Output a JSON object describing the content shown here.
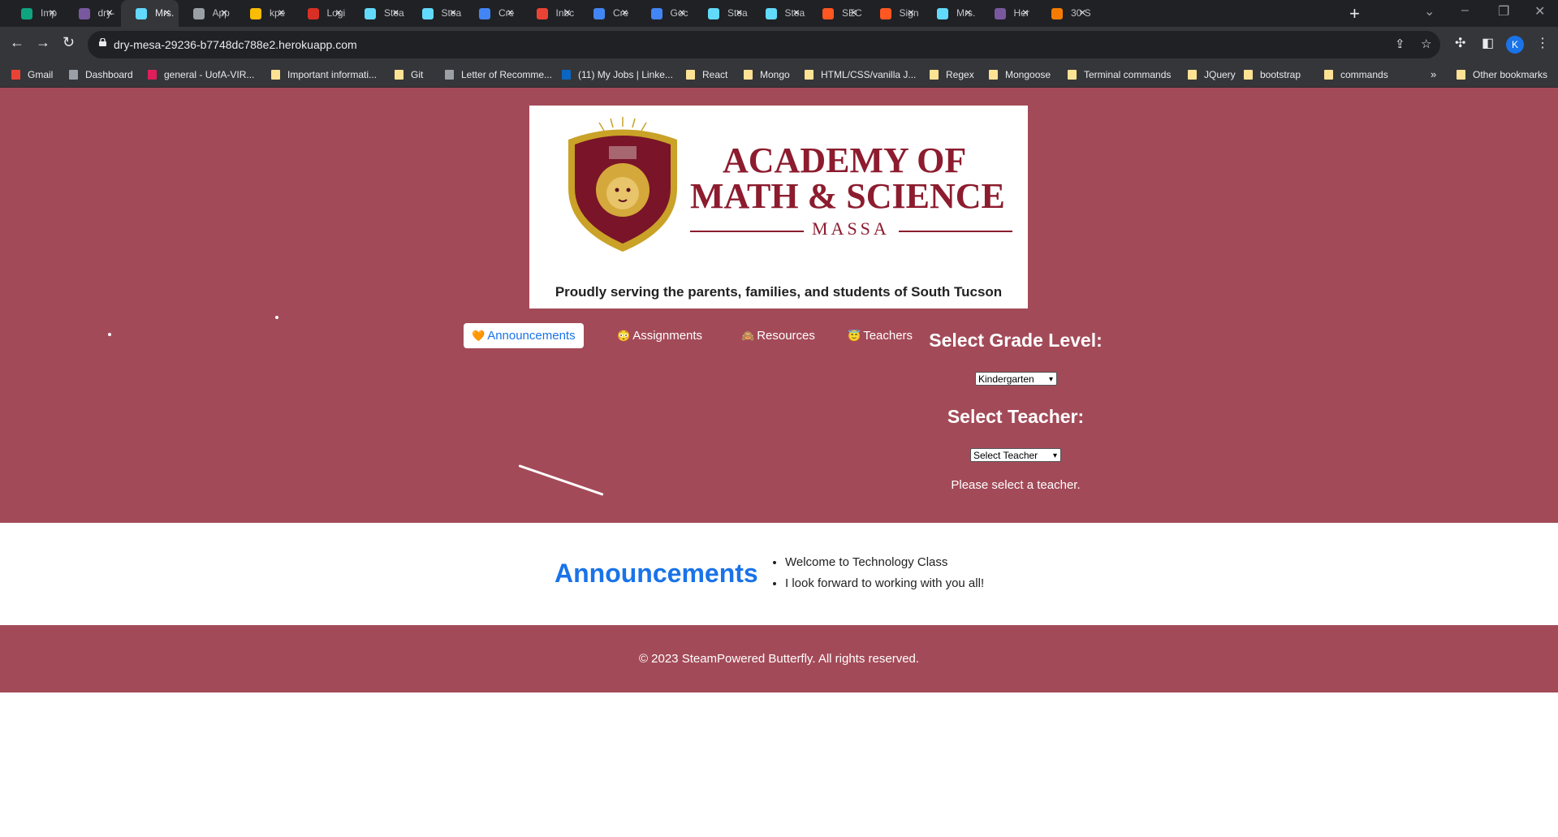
{
  "browser": {
    "tabs": [
      {
        "label": "Imp",
        "favicon": "openai-icon",
        "color": "#10a37f"
      },
      {
        "label": "dry-",
        "favicon": "heroku-icon",
        "color": "#79589f"
      },
      {
        "label": "Mrs.",
        "favicon": "react-icon",
        "color": "#61dafb"
      },
      {
        "label": "App",
        "favicon": "globe-icon",
        "color": "#9aa0a6"
      },
      {
        "label": "kpe",
        "favicon": "google-drive-icon",
        "color": "#fbbc04"
      },
      {
        "label": "Logi",
        "favicon": "red-circle-icon",
        "color": "#d93025"
      },
      {
        "label": "Stea",
        "favicon": "react-icon",
        "color": "#61dafb"
      },
      {
        "label": "Stea",
        "favicon": "react-icon",
        "color": "#61dafb"
      },
      {
        "label": "Cre",
        "favicon": "chrome-icon",
        "color": "#4285f4"
      },
      {
        "label": "Inbc",
        "favicon": "gmail-icon",
        "color": "#ea4335"
      },
      {
        "label": "Cre",
        "favicon": "google-icon",
        "color": "#4285f4"
      },
      {
        "label": "Goc",
        "favicon": "google-icon",
        "color": "#4285f4"
      },
      {
        "label": "Stea",
        "favicon": "react-icon",
        "color": "#61dafb"
      },
      {
        "label": "Stea",
        "favicon": "react-icon",
        "color": "#61dafb"
      },
      {
        "label": "SEC",
        "favicon": "swagger-icon",
        "color": "#ff5722"
      },
      {
        "label": "Sign",
        "favicon": "swagger-icon",
        "color": "#ff5722"
      },
      {
        "label": "Mrs.",
        "favicon": "react-icon",
        "color": "#61dafb"
      },
      {
        "label": "Her",
        "favicon": "heroku-icon",
        "color": "#79589f"
      },
      {
        "label": "30 S",
        "favicon": "thirty-icon",
        "color": "#f57c00"
      }
    ],
    "url": "dry-mesa-29236-b7748dc788e2.herokuapp.com",
    "profile_initial": "K",
    "bookmarks": [
      {
        "label": "Gmail",
        "icon": "gmail-icon"
      },
      {
        "label": "Dashboard",
        "icon": "dashboard-icon"
      },
      {
        "label": "general - UofA-VIR...",
        "icon": "slack-icon"
      },
      {
        "label": "Important informati...",
        "icon": "folder-icon"
      },
      {
        "label": "Git",
        "icon": "folder-icon"
      },
      {
        "label": "Letter of Recomme...",
        "icon": "document-icon"
      },
      {
        "label": "(11) My Jobs | Linke...",
        "icon": "linkedin-icon"
      },
      {
        "label": "React",
        "icon": "folder-icon"
      },
      {
        "label": "Mongo",
        "icon": "folder-icon"
      },
      {
        "label": "HTML/CSS/vanilla J...",
        "icon": "folder-icon"
      },
      {
        "label": "Regex",
        "icon": "folder-icon"
      },
      {
        "label": "Mongoose",
        "icon": "folder-icon"
      },
      {
        "label": "Terminal commands",
        "icon": "folder-icon"
      },
      {
        "label": "JQuery",
        "icon": "folder-icon"
      },
      {
        "label": "bootstrap",
        "icon": "folder-icon"
      },
      {
        "label": "commands",
        "icon": "folder-icon"
      }
    ],
    "more_bookmarks": "»",
    "other_bookmarks": "Other bookmarks"
  },
  "logo": {
    "line1": "ACADEMY OF",
    "line2": "MATH & SCIENCE",
    "sub": "MASSA",
    "tagline": "Proudly serving the parents, families, and students of South Tucson"
  },
  "nav": {
    "items": [
      {
        "emoji": "🧡",
        "label": "Announcements",
        "active": true
      },
      {
        "emoji": "😳",
        "label": "Assignments",
        "active": false
      },
      {
        "emoji": "🙈",
        "label": "Resources",
        "active": false
      },
      {
        "emoji": "😇",
        "label": "Teachers",
        "active": false
      }
    ]
  },
  "selectors": {
    "grade_title": "Select Grade Level:",
    "grade_value": "Kindergarten",
    "teacher_title": "Select Teacher:",
    "teacher_value": "Select Teacher",
    "hint": "Please select a teacher."
  },
  "announcements": {
    "title": "Announcements",
    "items": [
      "Welcome to Technology Class",
      "I look forward to working with you all!"
    ]
  },
  "footer": {
    "copyright": "© 2023 SteamPowered Butterfly. All rights reserved."
  },
  "colors": {
    "brand_maroon": "#a34a58",
    "logo_red": "#8c1c2e",
    "link_blue": "#1a73e8"
  }
}
